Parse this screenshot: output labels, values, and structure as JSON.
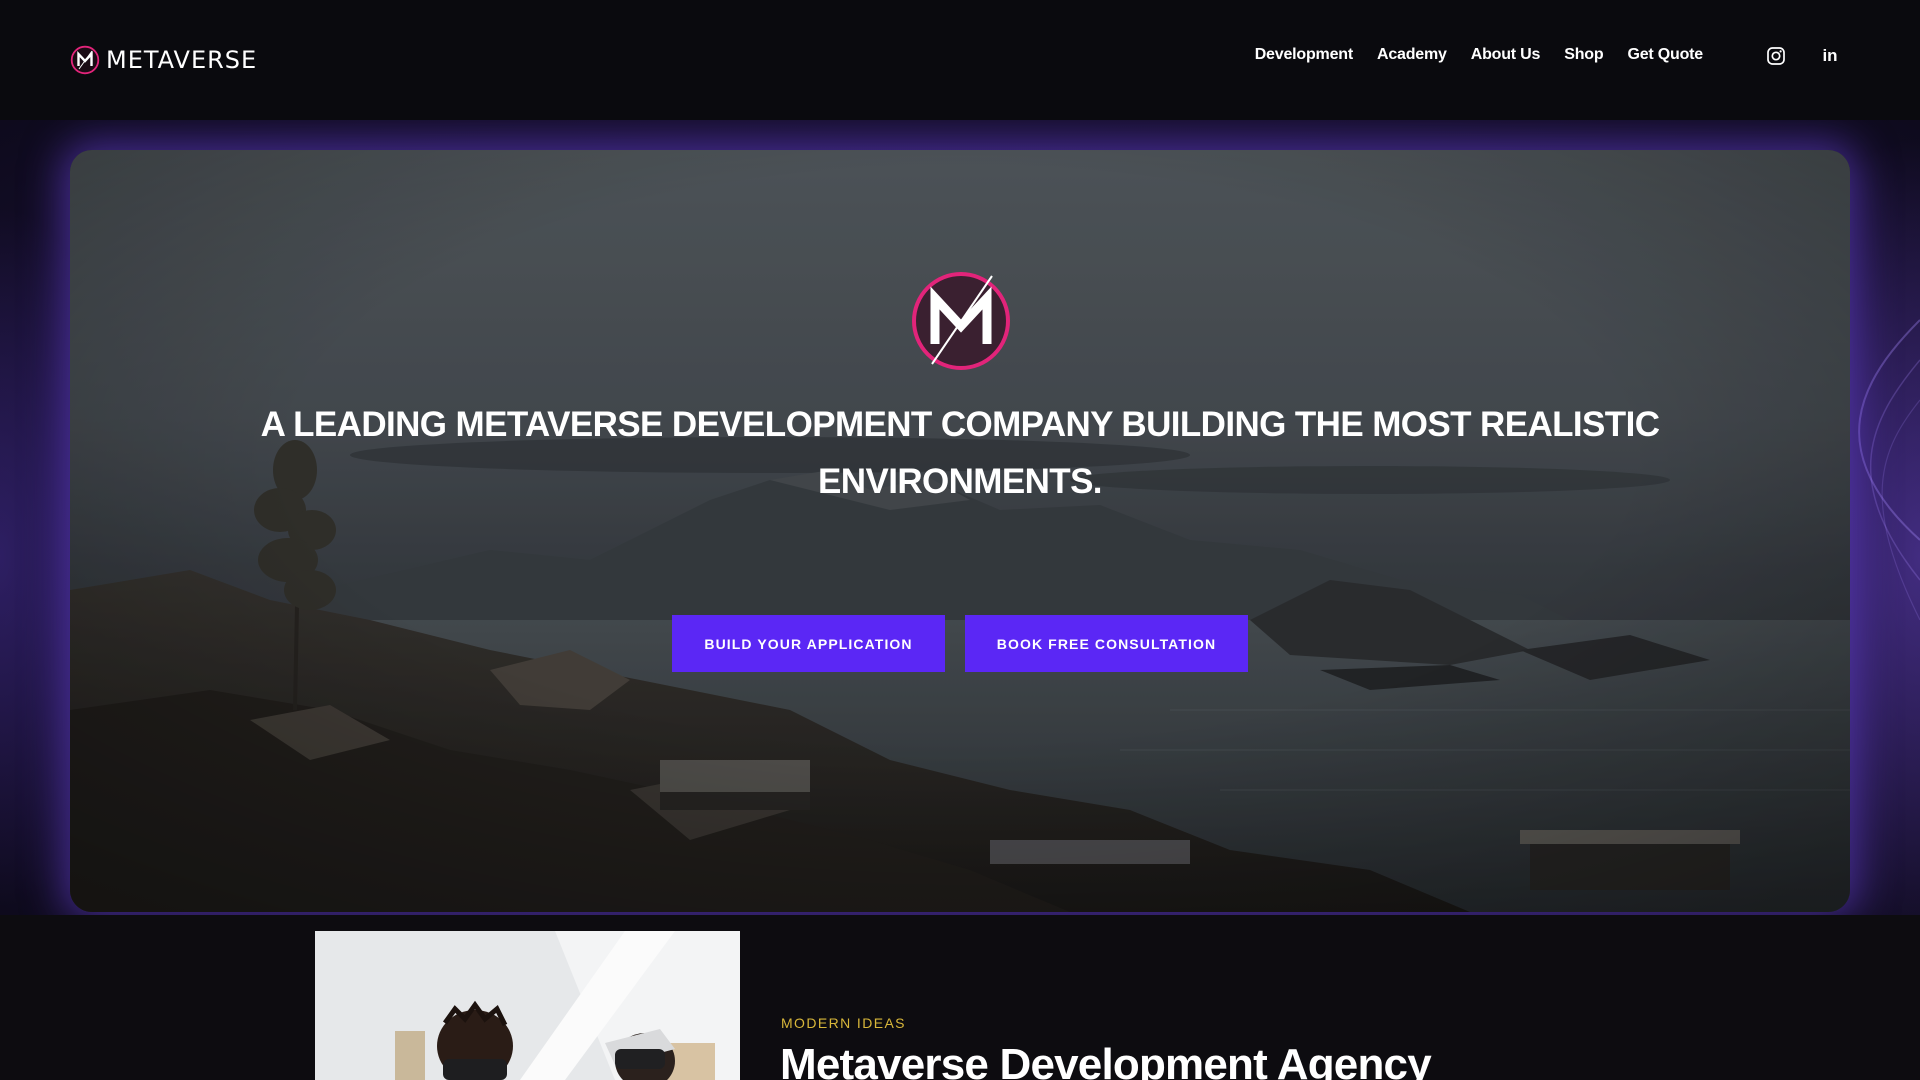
{
  "brand": {
    "name": "METAVERSE",
    "accent": "#5b27f5",
    "logo_ring": "#e2247a"
  },
  "nav": {
    "items": [
      {
        "label": "Development"
      },
      {
        "label": "Academy"
      },
      {
        "label": "About Us"
      },
      {
        "label": "Shop"
      },
      {
        "label": "Get Quote"
      }
    ]
  },
  "social": {
    "instagram_icon": "instagram-icon",
    "linkedin_icon": "linkedin-icon",
    "linkedin_glyph": "in"
  },
  "hero": {
    "title": "A LEADING METAVERSE DEVELOPMENT COMPANY BUILDING THE MOST REALISTIC ENVIRONMENTS.",
    "primary_button": "BUILD YOUR APPLICATION",
    "secondary_button": "BOOK FREE CONSULTATION"
  },
  "about": {
    "eyebrow": "MODERN IDEAS",
    "title": "Metaverse Development Agency",
    "eyebrow_color": "#d8b73a"
  }
}
